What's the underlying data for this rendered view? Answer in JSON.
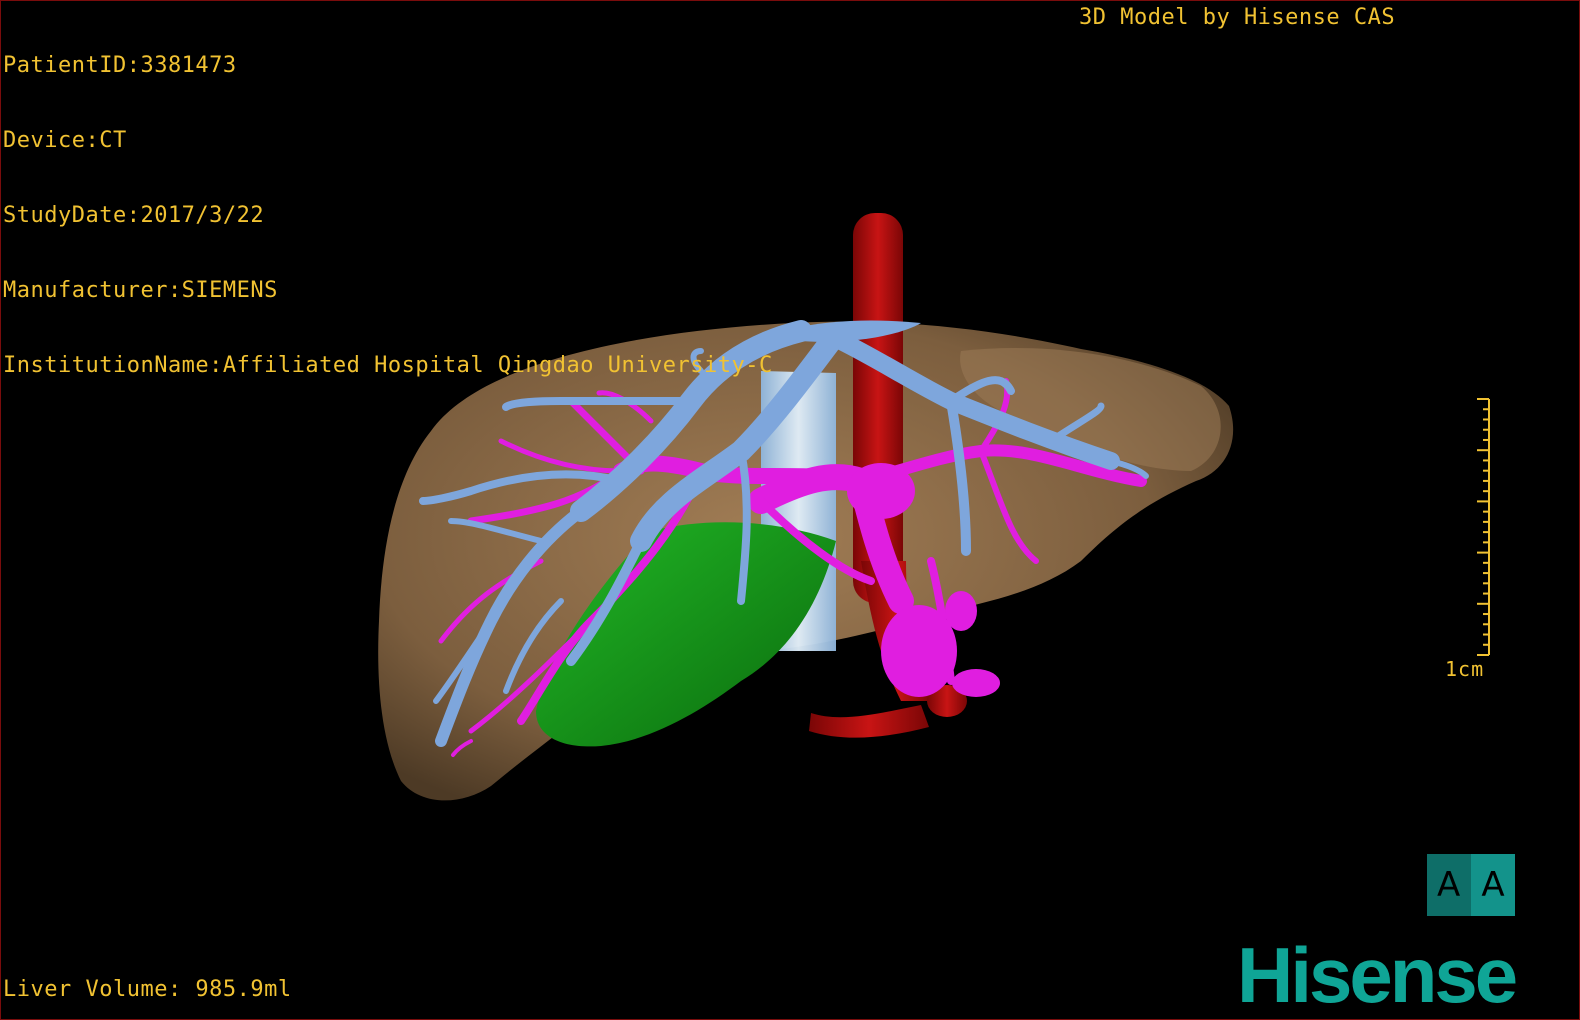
{
  "overlay": {
    "patient_id": "PatientID:3381473",
    "device": "Device:CT",
    "study_date": "StudyDate:2017/3/22",
    "manufacturer": "Manufacturer:SIEMENS",
    "institution": "InstitutionName:Affiliated Hospital Qingdao University-C",
    "brand_caption": "3D Model by Hisense CAS",
    "liver_volume": "Liver Volume: 985.9ml"
  },
  "scale": {
    "label": "1cm"
  },
  "orientation": {
    "left_face": "A",
    "right_face": "A"
  },
  "logo": {
    "text": "Hisense"
  },
  "colors": {
    "overlay_text": "#f1c232",
    "liver": "#8a6a47",
    "hepatic_vein": "#7ea6dc",
    "portal_vein": "#e01ee0",
    "aorta": "#b00b0b",
    "gallbladder": "#0f8a12",
    "ivc": "#b9d7ef",
    "brand": "#0fa596",
    "orientation_cube": "#0f7f78"
  }
}
